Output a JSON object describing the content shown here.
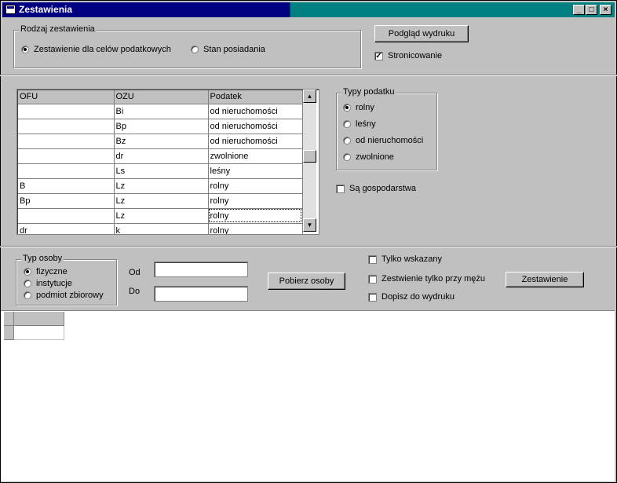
{
  "window": {
    "title": "Zestawienia",
    "buttons": {
      "minimize": "_",
      "maximize": "□",
      "close": "×"
    }
  },
  "rodzaj": {
    "title": "Rodzaj zestawienia",
    "options": [
      {
        "label": "Zestawienie dla celów podatkowych",
        "selected": true
      },
      {
        "label": "Stan posiadania",
        "selected": false
      }
    ]
  },
  "preview_button": "Podgląd wydruku",
  "stronicowanie": {
    "label": "Stronicowanie",
    "checked": true
  },
  "grid": {
    "columns": [
      "OFU",
      "OZU",
      "Podatek"
    ],
    "rows": [
      [
        "",
        "Bi",
        "od nieruchomości"
      ],
      [
        "",
        "Bp",
        "od nieruchomości"
      ],
      [
        "",
        "Bz",
        "od nieruchomości"
      ],
      [
        "",
        "dr",
        "zwolnione"
      ],
      [
        "",
        "Ls",
        "leśny"
      ],
      [
        "B",
        "Lz",
        "rolny"
      ],
      [
        "Bp",
        "Lz",
        "rolny"
      ],
      [
        "",
        "Lz",
        "rolny"
      ],
      [
        "dr",
        "k",
        "rolny"
      ]
    ],
    "selected_row": 7
  },
  "typy_podatku": {
    "title": "Typy podatku",
    "options": [
      {
        "label": "rolny",
        "selected": true
      },
      {
        "label": "leśny",
        "selected": false
      },
      {
        "label": "od nieruchomości",
        "selected": false
      },
      {
        "label": "zwolnione",
        "selected": false
      }
    ]
  },
  "gospodarstwa": {
    "label": "Są gospodarstwa",
    "checked": false
  },
  "typ_osoby": {
    "title": "Typ osoby",
    "options": [
      {
        "label": "fizyczne",
        "selected": true
      },
      {
        "label": "instytucje",
        "selected": false
      },
      {
        "label": "podmiot zbiorowy",
        "selected": false
      }
    ]
  },
  "od_label": "Od",
  "do_label": "Do",
  "od_value": "",
  "do_value": "",
  "pobierz_button": "Pobierz osoby",
  "tylko_wskazany": {
    "label": "Tylko wskazany",
    "checked": false
  },
  "tylko_przy_mezu": {
    "label": "Zestwienie tylko przy mężu",
    "checked": false
  },
  "dopisz": {
    "label": "Dopisz do wydruku",
    "checked": false
  },
  "zestawienie_button": "Zestawienie"
}
